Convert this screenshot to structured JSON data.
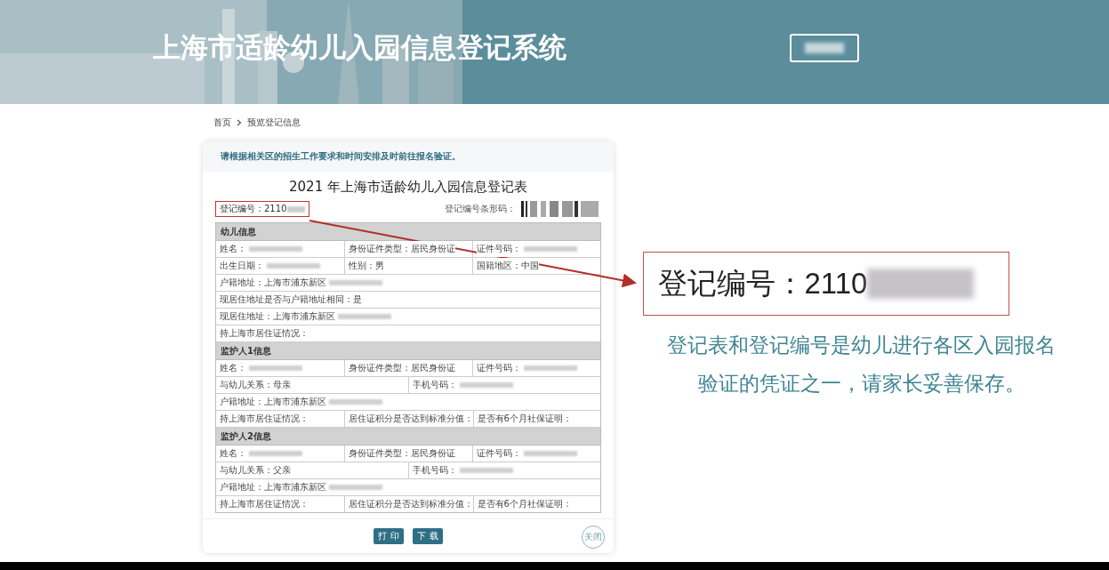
{
  "header": {
    "title": "上海市适龄幼儿入园信息登记系统"
  },
  "breadcrumb": [
    "首页",
    "预览登记信息"
  ],
  "notice": "请根据相关区的招生工作要求和时间安排及时前往报名验证。",
  "form": {
    "title": "2021 年上海市适龄幼儿入园信息登记表",
    "reg_label": "登记编号：",
    "reg_value": "2110",
    "barcode_label": "登记编号条形码：",
    "sections": [
      {
        "heading": "幼儿信息",
        "rows": [
          [
            {
              "label": "姓名：",
              "blurred": true
            },
            {
              "label": "身份证件类型：",
              "value": "居民身份证",
              "blurred": false
            },
            {
              "label": "证件号码：",
              "blurred": true
            }
          ],
          [
            {
              "label": "出生日期：",
              "blurred": true
            },
            {
              "label": "性别：",
              "value": "男",
              "blurred": false
            },
            {
              "label": "国籍地区：",
              "value": "中国",
              "blurred": false
            }
          ],
          [
            {
              "label": "户籍地址：",
              "value": "上海市浦东新区",
              "blurred": true
            }
          ],
          [
            {
              "label": "现居住地址是否与户籍地址相同：",
              "value": "是",
              "blurred": false
            }
          ],
          [
            {
              "label": "现居住地址：",
              "value": "上海市浦东新区",
              "blurred": true
            }
          ],
          [
            {
              "label": "持上海市居住证情况：",
              "blurred": false
            }
          ]
        ]
      },
      {
        "heading": "监护人1信息",
        "rows": [
          [
            {
              "label": "姓名：",
              "blurred": true
            },
            {
              "label": "身份证件类型：",
              "value": "居民身份证",
              "blurred": false
            },
            {
              "label": "证件号码：",
              "blurred": true
            }
          ],
          [
            {
              "label": "与幼儿关系：",
              "value": "母亲",
              "blurred": false
            },
            {
              "label": "手机号码：",
              "blurred": true
            }
          ],
          [
            {
              "label": "户籍地址：",
              "value": "上海市浦东新区",
              "blurred": true
            }
          ],
          [
            {
              "label": "持上海市居住证情况：",
              "blurred": false
            },
            {
              "label": "居住证积分是否达到标准分值：",
              "blurred": false
            },
            {
              "label": "是否有6个月社保证明：",
              "blurred": false
            }
          ]
        ]
      },
      {
        "heading": "监护人2信息",
        "rows": [
          [
            {
              "label": "姓名：",
              "blurred": true
            },
            {
              "label": "身份证件类型：",
              "value": "居民身份证",
              "blurred": false
            },
            {
              "label": "证件号码：",
              "blurred": true
            }
          ],
          [
            {
              "label": "与幼儿关系：",
              "value": "父亲",
              "blurred": false
            },
            {
              "label": "手机号码：",
              "blurred": true
            }
          ],
          [
            {
              "label": "户籍地址：",
              "value": "上海市浦东新区",
              "blurred": true
            }
          ],
          [
            {
              "label": "持上海市居住证情况：",
              "blurred": false
            },
            {
              "label": "居住证积分是否达到标准分值：",
              "blurred": false
            },
            {
              "label": "是否有6个月社保证明：",
              "blurred": false
            }
          ]
        ]
      }
    ],
    "buttons": [
      "打 印",
      "下 载"
    ],
    "close": "关闭"
  },
  "callout": {
    "label": "登记编号：",
    "value": "2110"
  },
  "caption": [
    "登记表和登记编号是幼儿进行各区入园报名",
    "验证的凭证之一，请家长妥善保存。"
  ]
}
